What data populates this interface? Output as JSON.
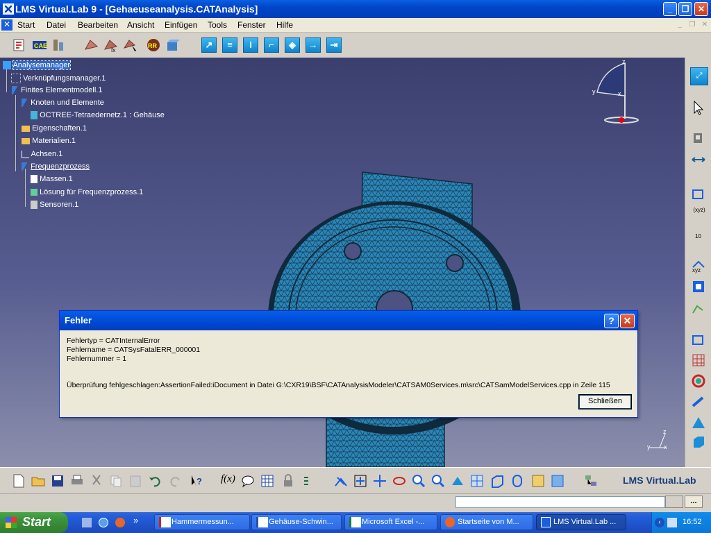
{
  "window": {
    "title": "LMS Virtual.Lab 9 - [Gehaeuseanalysis.CATAnalysis]",
    "minimize": "_",
    "maximize": "❐",
    "close": "✕"
  },
  "menubar": {
    "items": [
      {
        "label": "Start"
      },
      {
        "label": "Datei"
      },
      {
        "label": "Bearbeiten"
      },
      {
        "label": "Ansicht"
      },
      {
        "label": "Einfügen"
      },
      {
        "label": "Tools"
      },
      {
        "label": "Fenster"
      },
      {
        "label": "Hilfe"
      }
    ]
  },
  "tree": {
    "nodes": [
      {
        "label": "Analysemanager",
        "icon": "analysis-manager-icon",
        "selected": true
      },
      {
        "label": "Verknüpfungsmanager.1",
        "icon": "link-manager-icon"
      },
      {
        "label": "Finites Elementmodell.1",
        "icon": "fe-model-icon"
      },
      {
        "label": "Knoten und Elemente",
        "icon": "nodes-elements-icon"
      },
      {
        "label": "OCTREE-Tetraedernetz.1 : Gehäuse",
        "icon": "octree-mesh-icon"
      },
      {
        "label": "Eigenschaften.1",
        "icon": "folder-icon"
      },
      {
        "label": "Materialien.1",
        "icon": "folder-icon"
      },
      {
        "label": "Achsen.1",
        "icon": "axis-icon"
      },
      {
        "label": "Frequenzprozess",
        "icon": "frequency-process-icon",
        "underline": true
      },
      {
        "label": "Massen.1",
        "icon": "masses-icon"
      },
      {
        "label": "Lösung für Frequenzprozess.1",
        "icon": "solution-icon"
      },
      {
        "label": "Sensoren.1",
        "icon": "sensors-icon"
      }
    ]
  },
  "compass": {
    "z": "z",
    "y": "y",
    "x": "x"
  },
  "axis_triad": {
    "z": "z",
    "x": "x",
    "y": "y"
  },
  "dialog": {
    "title": "Fehler",
    "help": "?",
    "close": "✕",
    "lines": [
      "Fehlertyp = CATInternalError",
      "Fehlername = CATSysFatalERR_000001",
      "Fehlernummer = 1"
    ],
    "message": "Überprüfung fehlgeschlagen:AssertionFailed:iDocument in Datei G:\\CXR19\\BSF\\CATAnalysisModeler\\CATSAM0Services.m\\src\\CATSamModelServices.cpp in Zeile 115",
    "close_button": "Schließen"
  },
  "branding": {
    "label": "LMS Virtual.Lab"
  },
  "right_toolbar": {
    "xyz_label": "(xyz)",
    "ten_label": "10",
    "xyz_label2": "xyz"
  },
  "status": {
    "input_value": "",
    "more": "..."
  },
  "taskbar": {
    "start": "Start",
    "overflow": "»",
    "tasks": [
      {
        "label": "Hammermessun...",
        "icon": "pdf-icon"
      },
      {
        "label": "Gehäuse-Schwin...",
        "icon": "word-icon"
      },
      {
        "label": "Microsoft Excel -...",
        "icon": "excel-icon"
      },
      {
        "label": "Startseite von M...",
        "icon": "firefox-icon"
      },
      {
        "label": "LMS Virtual.Lab ...",
        "icon": "lms-icon",
        "active": true
      }
    ],
    "time": "16:52"
  },
  "colors": {
    "viewport_top": "#3a3f6e",
    "viewport_bottom": "#8c8fac",
    "mesh": "#2a7fb0",
    "xp_blue": "#0a5fe0"
  }
}
